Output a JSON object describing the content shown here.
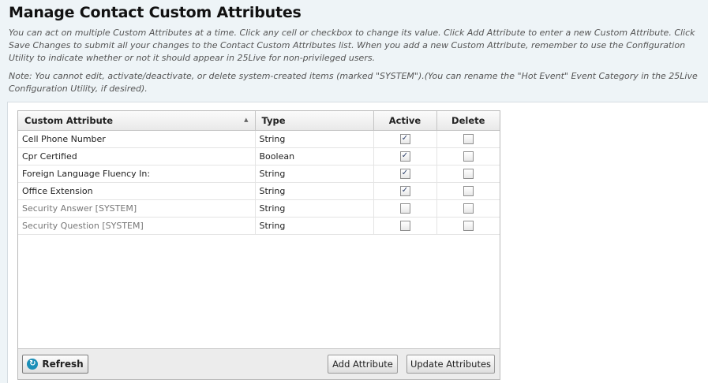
{
  "header": {
    "title": "Manage Contact Custom Attributes",
    "instructions": "You can act on multiple Custom Attributes at a time. Click any cell or checkbox to change its value. Click Add Attribute to enter a new Custom Attribute. Click Save Changes to submit all your changes to the Contact Custom Attributes list. When you add a new Custom Attribute, remember to use the Configuration Utility to indicate whether or not it should appear in 25Live for non-privileged users.",
    "note": "Note: You cannot edit, activate/deactivate, or delete system-created items (marked \"SYSTEM\").(You can rename the \"Hot Event\" Event Category in the 25Live Configuration Utility, if desired)."
  },
  "table": {
    "columns": {
      "name": "Custom Attribute",
      "type": "Type",
      "active": "Active",
      "delete": "Delete"
    },
    "sort_icon": "sort-ascending-icon",
    "rows": [
      {
        "name": "Cell Phone Number",
        "type": "String",
        "active": true,
        "delete": false,
        "system": false
      },
      {
        "name": "Cpr Certified",
        "type": "Boolean",
        "active": true,
        "delete": false,
        "system": false
      },
      {
        "name": "Foreign Language Fluency In:",
        "type": "String",
        "active": true,
        "delete": false,
        "system": false
      },
      {
        "name": "Office Extension",
        "type": "String",
        "active": true,
        "delete": false,
        "system": false
      },
      {
        "name": "Security Answer [SYSTEM]",
        "type": "String",
        "active": false,
        "delete": false,
        "system": true
      },
      {
        "name": "Security Question [SYSTEM]",
        "type": "String",
        "active": false,
        "delete": false,
        "system": true
      }
    ]
  },
  "toolbar": {
    "refresh_label": "Refresh",
    "refresh_icon": "refresh-icon",
    "add_label": "Add Attribute",
    "update_label": "Update Attributes"
  }
}
